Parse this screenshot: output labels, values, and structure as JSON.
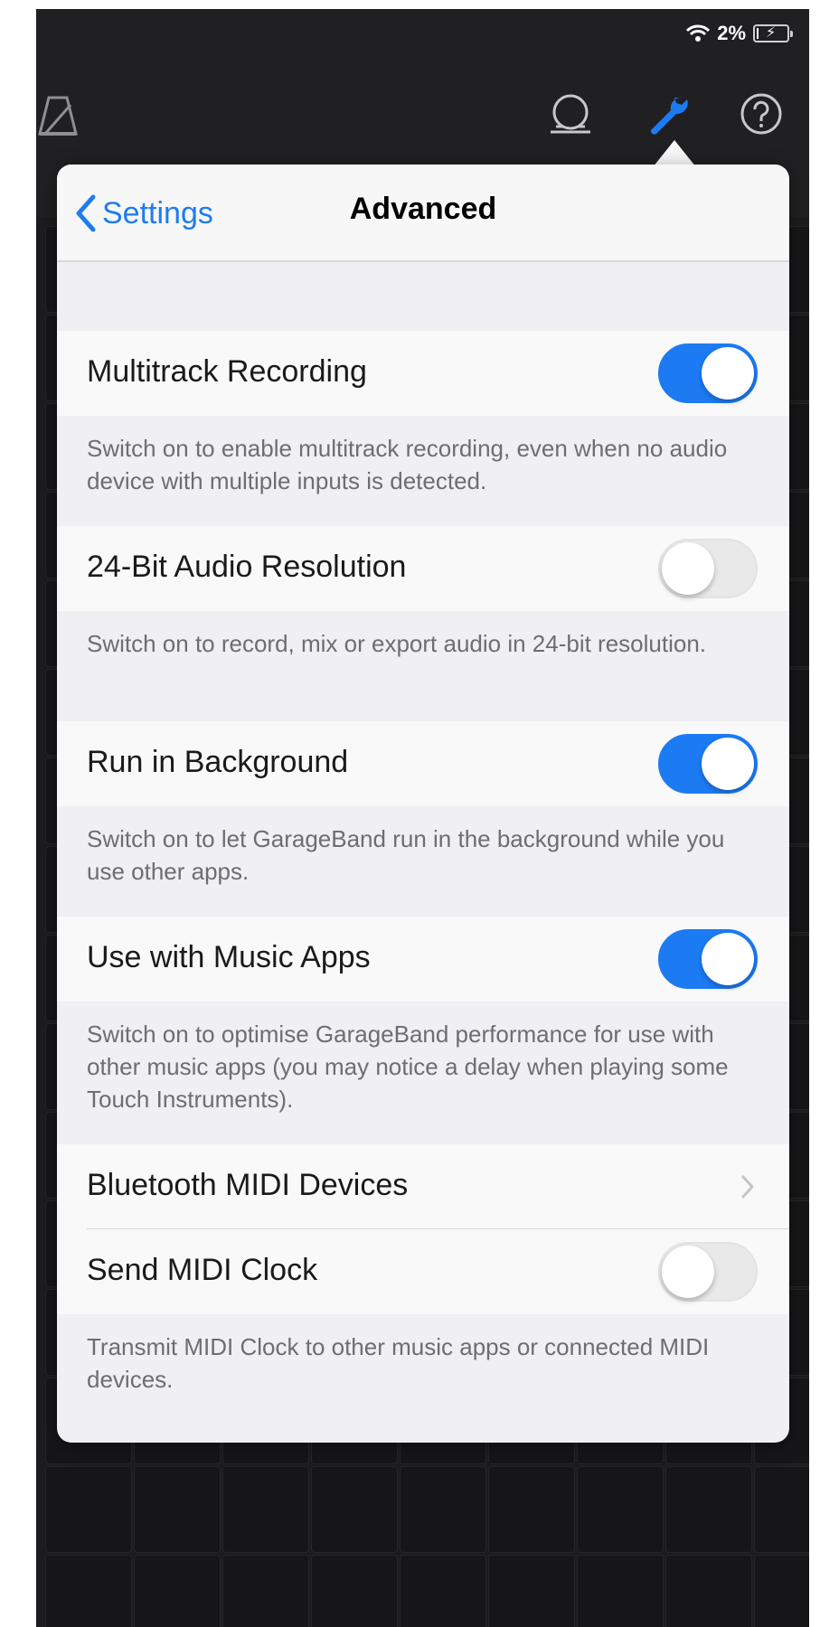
{
  "status_bar": {
    "battery_percent": "2%",
    "battery_level": 0.02
  },
  "navigation": {
    "back_label": "Settings",
    "title": "Advanced"
  },
  "settings": [
    {
      "label": "Multitrack Recording",
      "toggle": true,
      "footer": "Switch on to enable multitrack recording, even when no audio device with multiple inputs is detected."
    },
    {
      "label": "24-Bit Audio Resolution",
      "toggle": false,
      "footer": "Switch on to record, mix or export audio in 24-bit resolution."
    },
    {
      "label": "Run in Background",
      "toggle": true,
      "footer": "Switch on to let GarageBand run in the background while you use other apps."
    },
    {
      "label": "Use with Music Apps",
      "toggle": true,
      "footer": "Switch on to optimise GarageBand performance for use with other music apps (you may notice a delay when playing some Touch Instruments)."
    },
    {
      "label": "Bluetooth MIDI Devices"
    },
    {
      "label": "Send MIDI Clock",
      "toggle": false,
      "footer": "Transmit MIDI Clock to other music apps or connected MIDI devices."
    }
  ],
  "icons": [
    "wifi-icon",
    "battery-icon",
    "metronome-icon",
    "loop-icon",
    "wrench-icon",
    "help-icon",
    "chevron-left-icon",
    "chevron-right-icon"
  ],
  "colors": {
    "accent": "#1c7bf3",
    "toggle_off": "#e9e9ea",
    "background_dark": "#1c1c1e",
    "group_background": "#efeff4"
  }
}
